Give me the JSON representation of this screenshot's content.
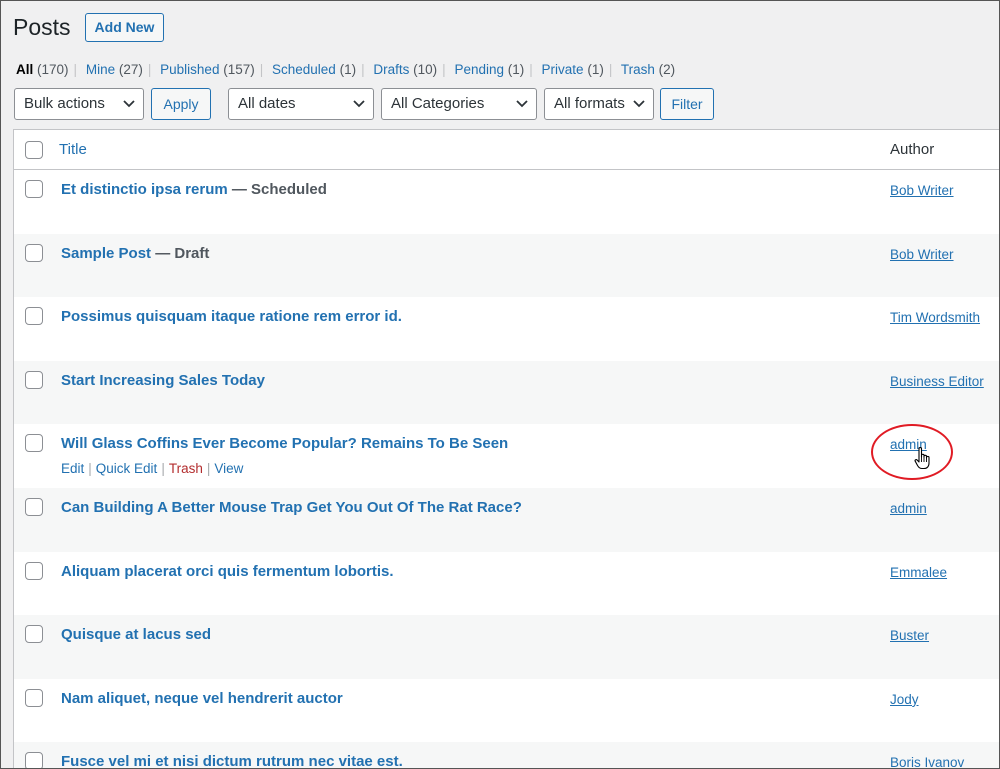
{
  "header": {
    "title": "Posts",
    "add_new": "Add New"
  },
  "filters": {
    "all": "All",
    "all_count": "(170)",
    "mine": "Mine",
    "mine_count": "(27)",
    "published": "Published",
    "published_count": "(157)",
    "scheduled": "Scheduled",
    "scheduled_count": "(1)",
    "drafts": "Drafts",
    "drafts_count": "(10)",
    "pending": "Pending",
    "pending_count": "(1)",
    "private": "Private",
    "private_count": "(1)",
    "trash": "Trash",
    "trash_count": "(2)"
  },
  "toolbar": {
    "bulk_actions": "Bulk actions",
    "apply": "Apply",
    "dates": "All dates",
    "categories": "All Categories",
    "formats": "All formats",
    "filter": "Filter"
  },
  "table": {
    "col_title": "Title",
    "col_author": "Author",
    "state_sep": " — ",
    "row_actions": {
      "edit": "Edit",
      "quick_edit": "Quick Edit",
      "trash": "Trash",
      "view": "View"
    },
    "rows": [
      {
        "title": "Et distinctio ipsa rerum",
        "state": "Scheduled",
        "author": "Bob Writer"
      },
      {
        "title": "Sample Post",
        "state": "Draft",
        "author": "Bob Writer"
      },
      {
        "title": "Possimus quisquam itaque ratione rem error id.",
        "state": "",
        "author": "Tim Wordsmith"
      },
      {
        "title": "Start Increasing Sales Today",
        "state": "",
        "author": "Business Editor"
      },
      {
        "title": "Will Glass Coffins Ever Become Popular? Remains To Be Seen",
        "state": "",
        "author": "admin"
      },
      {
        "title": "Can Building A Better Mouse Trap Get You Out Of The Rat Race?",
        "state": "",
        "author": "admin"
      },
      {
        "title": "Aliquam placerat orci quis fermentum lobortis.",
        "state": "",
        "author": "Emmalee"
      },
      {
        "title": "Quisque at lacus sed",
        "state": "",
        "author": "Buster"
      },
      {
        "title": "Nam aliquet, neque vel hendrerit auctor",
        "state": "",
        "author": "Jody"
      },
      {
        "title": "Fusce vel mi et nisi dictum rutrum nec vitae est.",
        "state": "",
        "author": "Boris Ivanov"
      }
    ]
  },
  "icons": {
    "select_arrow": "chevron-down-icon",
    "cursor": "hand-pointer-icon"
  },
  "colors": {
    "link": "#2271b1",
    "trash": "#b32d2e",
    "highlight": "#e01b24"
  }
}
